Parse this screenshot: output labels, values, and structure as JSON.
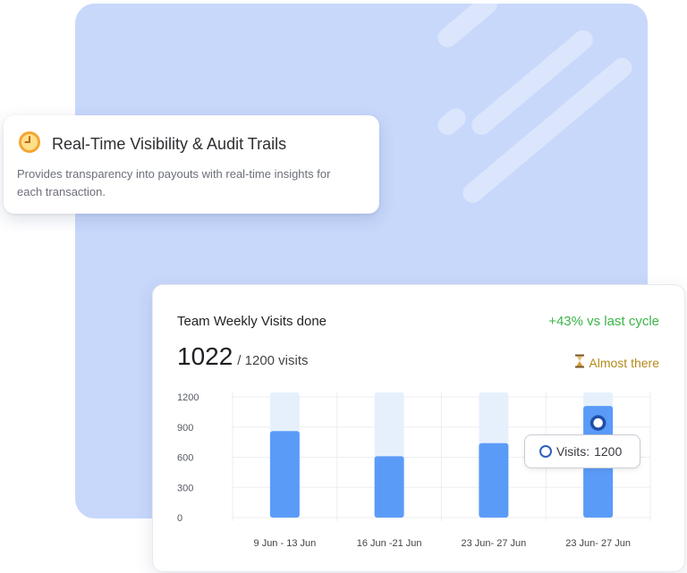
{
  "info_card": {
    "icon": "clock-icon",
    "title": "Real-Time Visibility & Audit Trails",
    "description": "Provides transparency into payouts with real-time insights for each transaction."
  },
  "chart_card": {
    "title": "Team Weekly Visits done",
    "trend": "+43% vs last cycle",
    "current": "1022",
    "target_text": "/ 1200 visits",
    "status_icon": "hourglass-icon",
    "status": "Almost there",
    "tooltip": {
      "label": "Visits:",
      "value": "1200"
    }
  },
  "colors": {
    "bar": "#5b9bf8",
    "bar_track": "#e6f0fd",
    "trend_green": "#3bb54a",
    "status_gold": "#b28a1c",
    "panel": "#c8d8fb"
  },
  "chart_data": {
    "type": "bar",
    "categories": [
      "9 Jun - 13 Jun",
      "16 Jun -21 Jun",
      "23 Jun- 27 Jun",
      "23 Jun- 27 Jun"
    ],
    "values": [
      860,
      610,
      740,
      1110
    ],
    "ylim": [
      0,
      1200
    ],
    "yticks": [
      1200,
      900,
      600,
      300,
      0
    ],
    "grid": true,
    "highlight_index": 3,
    "title": "",
    "xlabel": "",
    "ylabel": ""
  }
}
